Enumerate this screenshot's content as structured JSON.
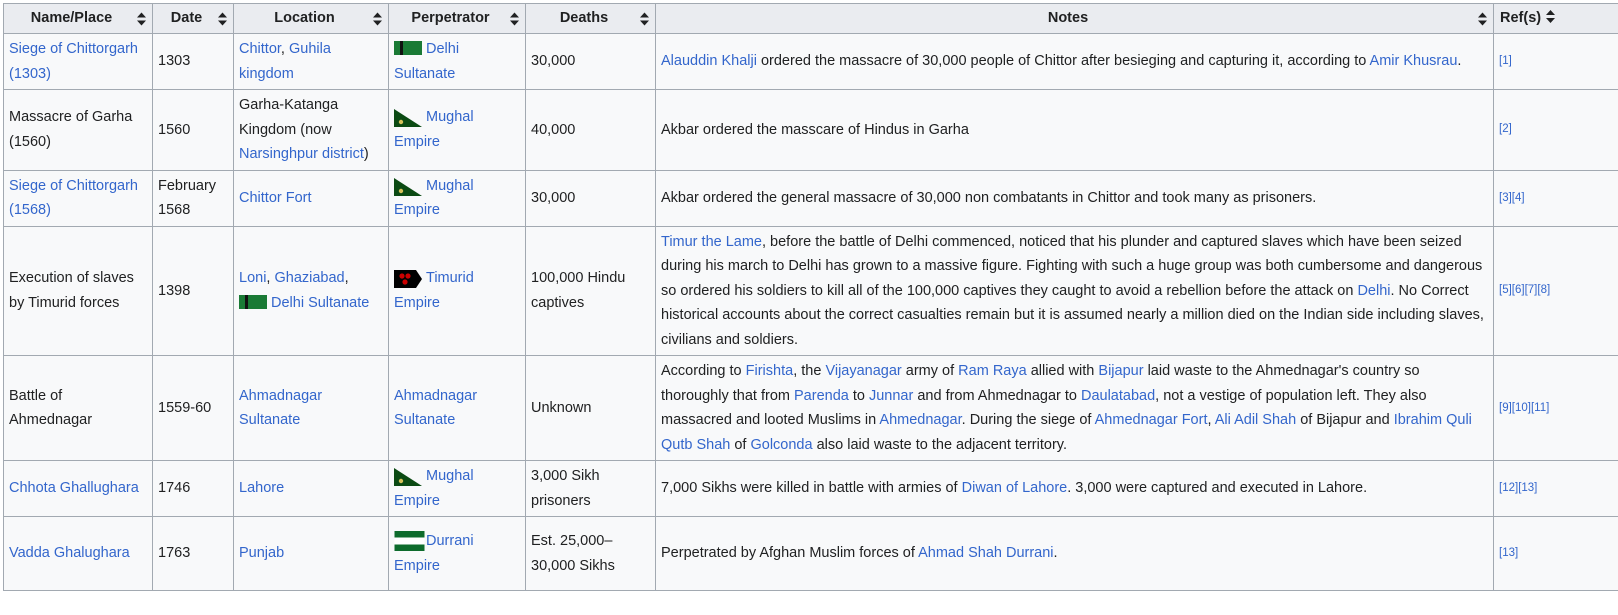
{
  "table": {
    "headers": [
      "Name/Place",
      "Date",
      "Location",
      "Perpetrator",
      "Deaths",
      "Notes",
      "Ref(s)"
    ],
    "rows": [
      {
        "name": [
          {
            "t": "Siege of Chittorgarh (1303)",
            "link": true
          }
        ],
        "date": "1303",
        "location": [
          {
            "t": "Chittor",
            "link": true
          },
          {
            "t": ", ",
            "link": false
          },
          {
            "t": "Guhila kingdom",
            "link": true
          }
        ],
        "perpetrator": {
          "flag": "delhi-sultanate-flag",
          "label": "Delhi Sultanate"
        },
        "deaths": "30,000",
        "notes": [
          {
            "t": "Alauddin Khalji",
            "link": true
          },
          {
            "t": " ordered the massacre of 30,000 people of Chittor after besieging and capturing it, according to ",
            "link": false
          },
          {
            "t": "Amir Khusrau",
            "link": true
          },
          {
            "t": ".",
            "link": false
          }
        ],
        "refs": [
          "[1]"
        ]
      },
      {
        "name": [
          {
            "t": "Massacre of Garha (1560)",
            "link": false
          }
        ],
        "date": "1560",
        "location": [
          {
            "t": "Garha-Katanga Kingdom (now ",
            "link": false
          },
          {
            "t": "Narsinghpur district",
            "link": true
          },
          {
            "t": ")",
            "link": false
          }
        ],
        "perpetrator": {
          "flag": "mughal-empire-flag",
          "label": "Mughal Empire"
        },
        "deaths": "40,000",
        "notes": [
          {
            "t": "Akbar ordered the masscare of Hindus in Garha",
            "link": false
          }
        ],
        "refs": [
          "[2]"
        ]
      },
      {
        "name": [
          {
            "t": "Siege of Chittorgarh (1568)",
            "link": true
          }
        ],
        "date": "February 1568",
        "location": [
          {
            "t": "Chittor Fort",
            "link": true
          }
        ],
        "perpetrator": {
          "flag": "mughal-empire-flag",
          "label": "Mughal Empire"
        },
        "deaths": "30,000",
        "notes": [
          {
            "t": "Akbar ordered the general massacre of 30,000 non combatants in Chittor and took many as prisoners.",
            "link": false
          }
        ],
        "refs": [
          "[3]",
          "[4]"
        ]
      },
      {
        "name": [
          {
            "t": "Execution of slaves by Timurid forces",
            "link": false
          }
        ],
        "date": "1398",
        "location": [
          {
            "t": "Loni",
            "link": true
          },
          {
            "t": ", ",
            "link": false
          },
          {
            "t": "Ghaziabad",
            "link": true
          },
          {
            "t": ",",
            "link": false
          },
          {
            "t": "BR",
            "link": false
          },
          {
            "flag": "delhi-sultanate-flag"
          },
          {
            "t": "Delhi Sultanate",
            "link": true
          }
        ],
        "perpetrator": {
          "flag": "timurid-empire-flag",
          "label": "Timurid Empire"
        },
        "deaths": "100,000 Hindu captives",
        "notes": [
          {
            "t": "Timur the Lame",
            "link": true
          },
          {
            "t": ", before the battle of Delhi commenced, noticed that his plunder and captured slaves which have been seized during his march to Delhi has grown to a massive figure. Fighting with such a huge group was both cumbersome and dangerous so ordered his soldiers to kill all of the 100,000 captives they caught to avoid a rebellion before the attack on ",
            "link": false
          },
          {
            "t": "Delhi",
            "link": true
          },
          {
            "t": ". No Correct historical accounts about the correct casualties remain but it is assumed nearly a million died on the Indian side including slaves, civilians and soldiers.",
            "link": false
          }
        ],
        "refs": [
          "[5]",
          "[6]",
          "[7]",
          "[8]"
        ]
      },
      {
        "name": [
          {
            "t": "Battle of Ahmednagar",
            "link": false
          }
        ],
        "date": "1559-60",
        "location": [
          {
            "t": "Ahmadnagar Sultanate",
            "link": true
          }
        ],
        "perpetrator": {
          "flag": null,
          "label": "Ahmadnagar Sultanate"
        },
        "deaths": "Unknown",
        "notes": [
          {
            "t": "According to ",
            "link": false
          },
          {
            "t": "Firishta",
            "link": true
          },
          {
            "t": ", the ",
            "link": false
          },
          {
            "t": "Vijayanagar",
            "link": true
          },
          {
            "t": " army of ",
            "link": false
          },
          {
            "t": "Ram Raya",
            "link": true
          },
          {
            "t": " allied with ",
            "link": false
          },
          {
            "t": "Bijapur",
            "link": true
          },
          {
            "t": " laid waste to the Ahmednagar's country so thoroughly that from ",
            "link": false
          },
          {
            "t": "Parenda",
            "link": true
          },
          {
            "t": " to ",
            "link": false
          },
          {
            "t": "Junnar",
            "link": true
          },
          {
            "t": " and from Ahmednagar to ",
            "link": false
          },
          {
            "t": "Daulatabad",
            "link": true
          },
          {
            "t": ", not a vestige of population left. They also massacred and looted Muslims in ",
            "link": false
          },
          {
            "t": "Ahmednagar",
            "link": true
          },
          {
            "t": ". During the siege of ",
            "link": false
          },
          {
            "t": "Ahmednagar Fort",
            "link": true
          },
          {
            "t": ", ",
            "link": false
          },
          {
            "t": "Ali Adil Shah",
            "link": true
          },
          {
            "t": " of Bijapur and ",
            "link": false
          },
          {
            "t": "Ibrahim Quli Qutb Shah",
            "link": true
          },
          {
            "t": " of ",
            "link": false
          },
          {
            "t": "Golconda",
            "link": true
          },
          {
            "t": " also laid waste to the adjacent territory.",
            "link": false
          }
        ],
        "refs": [
          "[9]",
          "[10]",
          "[11]"
        ]
      },
      {
        "name": [
          {
            "t": "Chhota Ghallughara",
            "link": true
          }
        ],
        "date": "1746",
        "location": [
          {
            "t": "Lahore",
            "link": true
          }
        ],
        "perpetrator": {
          "flag": "mughal-empire-flag",
          "label": "Mughal Empire"
        },
        "deaths": "3,000 Sikh prisoners",
        "notes": [
          {
            "t": "7,000 Sikhs were killed in battle with armies of ",
            "link": false
          },
          {
            "t": "Diwan of Lahore",
            "link": true
          },
          {
            "t": ". 3,000 were captured and executed in Lahore.",
            "link": false
          }
        ],
        "refs": [
          "[12]",
          "[13]"
        ]
      },
      {
        "name": [
          {
            "t": "Vadda Ghalughara",
            "link": true
          }
        ],
        "date": "1763",
        "location": [
          {
            "t": "Punjab",
            "link": true
          }
        ],
        "perpetrator": {
          "flag": "durrani-empire-flag",
          "label": "Durrani Empire"
        },
        "deaths": "Est. 25,000–30,000 Sikhs",
        "notes": [
          {
            "t": "Perpetrated by Afghan Muslim forces of ",
            "link": false
          },
          {
            "t": "Ahmad Shah Durrani",
            "link": true
          },
          {
            "t": ".",
            "link": false
          }
        ],
        "refs": [
          "[13]"
        ]
      }
    ]
  },
  "colors": {
    "link": "#3366cc",
    "text": "#202122",
    "header_bg": "#eaecf0",
    "cell_bg": "#f8f9fa",
    "border": "#a2a9b1"
  }
}
